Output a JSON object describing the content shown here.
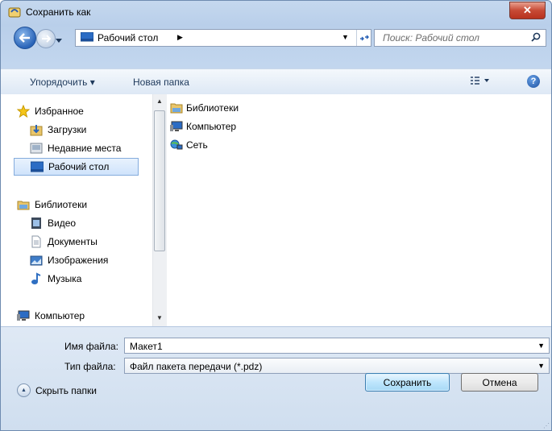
{
  "window": {
    "title": "Сохранить как",
    "close_glyph": "✕"
  },
  "nav": {
    "address": "Рабочий стол",
    "search_placeholder": "Поиск: Рабочий стол"
  },
  "toolbar": {
    "organize": "Упорядочить ▾",
    "new_folder": "Новая папка",
    "help": "?"
  },
  "sidebar": {
    "items": [
      {
        "label": "Избранное",
        "icon": "star-icon"
      },
      {
        "label": "Загрузки",
        "icon": "downloads-icon"
      },
      {
        "label": "Недавние места",
        "icon": "recent-places-icon"
      },
      {
        "label": "Рабочий стол",
        "icon": "desktop-icon",
        "selected": true
      },
      {
        "label": "Библиотеки",
        "icon": "libraries-icon"
      },
      {
        "label": "Видео",
        "icon": "video-icon"
      },
      {
        "label": "Документы",
        "icon": "documents-icon"
      },
      {
        "label": "Изображения",
        "icon": "pictures-icon"
      },
      {
        "label": "Музыка",
        "icon": "music-icon"
      },
      {
        "label": "Компьютер",
        "icon": "computer-icon"
      }
    ]
  },
  "files": [
    {
      "label": "Библиотеки",
      "icon": "libraries-icon"
    },
    {
      "label": "Компьютер",
      "icon": "computer-icon"
    },
    {
      "label": "Сеть",
      "icon": "network-icon"
    }
  ],
  "form": {
    "filename_label": "Имя файла:",
    "filename_value": "Макет1",
    "filetype_label": "Тип файла:",
    "filetype_value": "Файл пакета передачи (*.pdz)"
  },
  "footer": {
    "hide_folders": "Скрыть папки",
    "save": "Сохранить",
    "cancel": "Отмена"
  },
  "colors": {
    "accent": "#2a64b8",
    "selection": "#cfe3fb",
    "title_bar": "#c5d8ee"
  }
}
